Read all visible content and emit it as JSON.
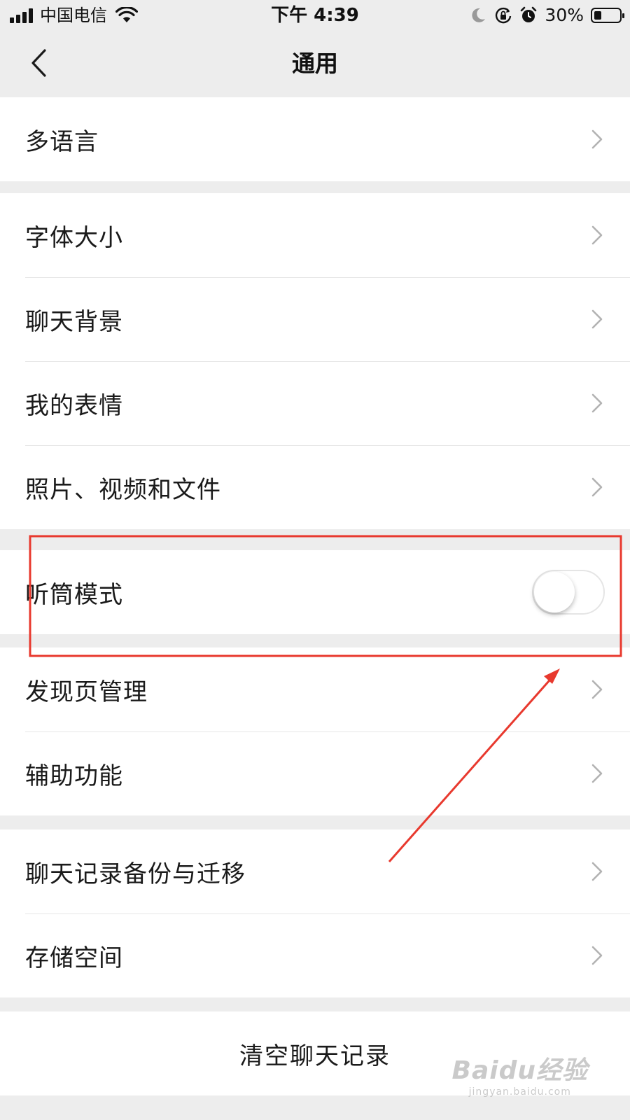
{
  "status_bar": {
    "carrier": "中国电信",
    "time": "下午 4:39",
    "battery_percent": "30%",
    "battery_level": 0.3,
    "icons": [
      "signal-icon",
      "wifi-icon",
      "moon-icon",
      "rotation-lock-icon",
      "alarm-icon",
      "battery-icon"
    ]
  },
  "nav": {
    "title": "通用",
    "back_icon": "chevron-left-icon"
  },
  "groups": {
    "g1": {
      "items": [
        {
          "label": "多语言"
        }
      ]
    },
    "g2": {
      "items": [
        {
          "label": "字体大小"
        },
        {
          "label": "聊天背景"
        },
        {
          "label": "我的表情"
        },
        {
          "label": "照片、视频和文件"
        }
      ]
    },
    "g3": {
      "items": [
        {
          "label": "听筒模式",
          "toggle_on": false
        }
      ]
    },
    "g4": {
      "items": [
        {
          "label": "发现页管理"
        },
        {
          "label": "辅助功能"
        }
      ]
    },
    "g5": {
      "items": [
        {
          "label": "聊天记录备份与迁移"
        },
        {
          "label": "存储空间"
        }
      ]
    }
  },
  "clear_button": {
    "label": "清空聊天记录"
  },
  "annotation": {
    "color": "#e8392e"
  },
  "watermark": {
    "logo": "Baidu经验",
    "url": "jingyan.baidu.com"
  },
  "colors": {
    "background": "#ededed",
    "row_background": "#ffffff",
    "chevron": "#b2b2b2"
  }
}
